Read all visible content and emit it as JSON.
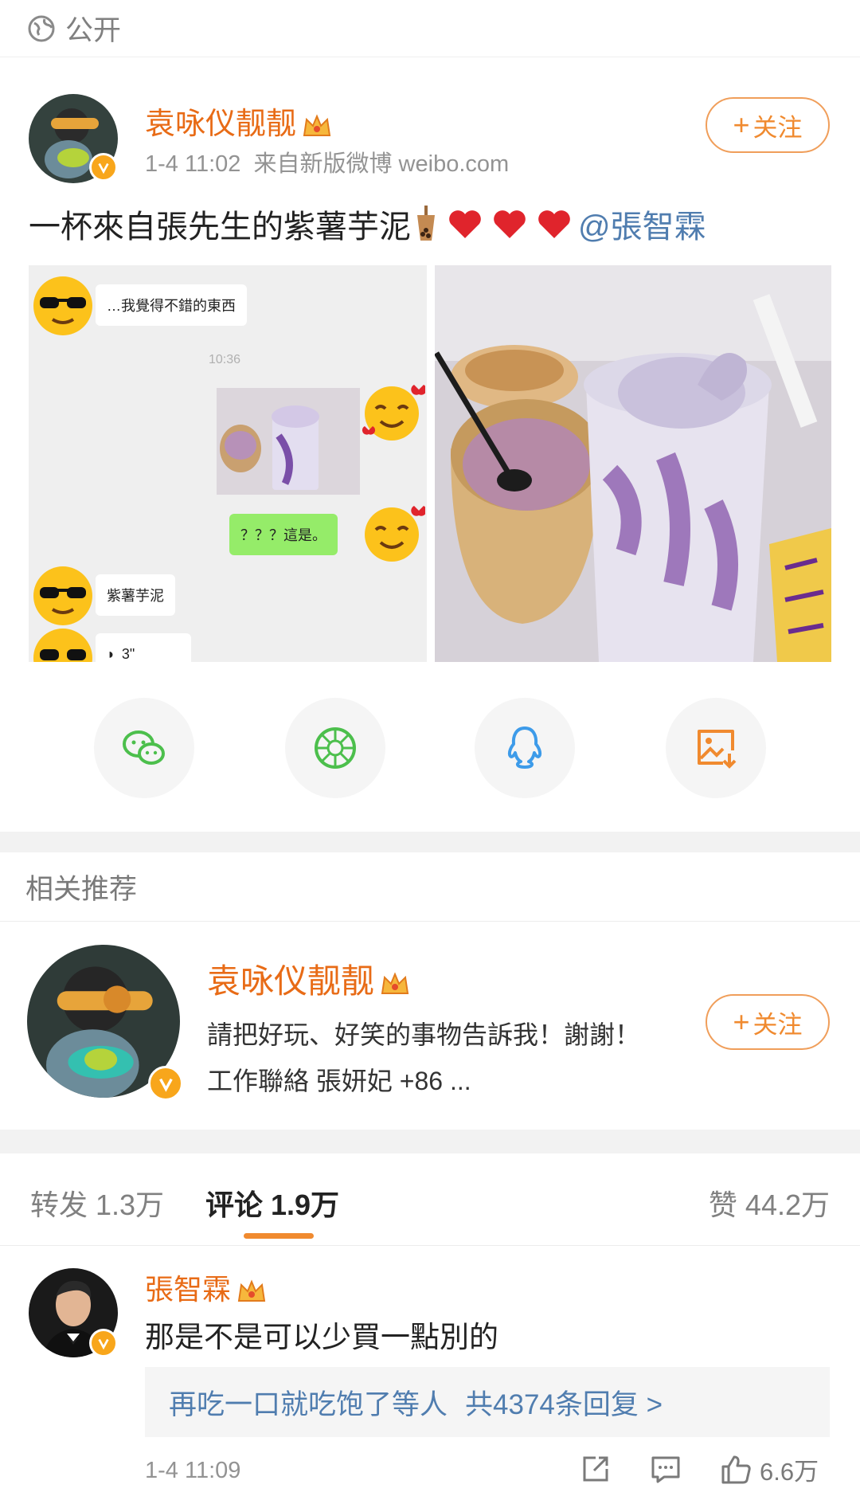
{
  "visibility": {
    "label": "公开",
    "icon": "globe-icon"
  },
  "post": {
    "author": "袁咏仪靓靓",
    "meta": "1-4 11:02  来自新版微博 weibo.com",
    "follow_label": "关注",
    "text": "一杯來自張先生的紫薯芋泥",
    "mention": "@張智霖",
    "chat": {
      "msg1": "…我覺得不錯的東西",
      "time": "10:36",
      "msg2": "？？？這是。",
      "msg3": "紫薯芋泥",
      "voice": "3\""
    }
  },
  "share": {
    "items": [
      {
        "icon": "wechat-icon",
        "color": "#4cbf4c"
      },
      {
        "icon": "moments-icon",
        "color": "#4cbf4c"
      },
      {
        "icon": "qq-icon",
        "color": "#3d9be9"
      },
      {
        "icon": "save-image-icon",
        "color": "#f08a2f"
      }
    ]
  },
  "related": {
    "title": "相关推荐",
    "name": "袁咏仪靓靓",
    "desc": "請把好玩、好笑的事物告訴我！謝謝！ 工作聯絡 張妍妃 +86 ...",
    "follow_label": "关注"
  },
  "tabs": {
    "repost": "转发 1.3万",
    "comments": "评论 1.9万",
    "likes": "赞 44.2万"
  },
  "comment": {
    "author": "張智霖",
    "text": "那是不是可以少買一點別的",
    "reply_user": "再吃一口就吃饱了等人",
    "reply_count": "共4374条回复 >",
    "time": "1-4 11:09",
    "likes": "6.6万"
  },
  "colors": {
    "accent": "#f08a2f",
    "name": "#e86b16",
    "link": "#507daf"
  }
}
